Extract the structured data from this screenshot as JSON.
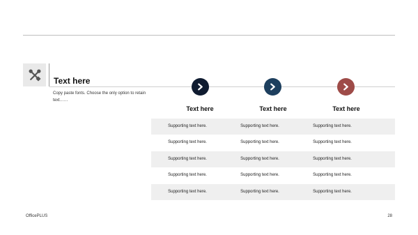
{
  "header": {
    "title": "Text here",
    "description": "Copy paste fonts. Choose the only option to retain text……"
  },
  "icons": {
    "tools": "tools-icon",
    "arrow": "chevron-right-icon"
  },
  "columns": [
    {
      "title": "Text here",
      "color": "#0f1b30"
    },
    {
      "title": "Text here",
      "color": "#1d3f5e"
    },
    {
      "title": "Text here",
      "color": "#9e4b48"
    }
  ],
  "rows": [
    [
      "Supporting text here.",
      "Supporting text here.",
      "Supporting text here."
    ],
    [
      "Supporting text here.",
      "Supporting text here.",
      "Supporting text here."
    ],
    [
      "Supporting text here.",
      "Supporting text here.",
      "Supporting text here."
    ],
    [
      "Supporting text here.",
      "Supporting text here.",
      "Supporting text here."
    ],
    [
      "Supporting text here.",
      "Supporting text here.",
      "Supporting text here."
    ]
  ],
  "footer": {
    "brand": "OfficePLUS",
    "page": "28"
  }
}
